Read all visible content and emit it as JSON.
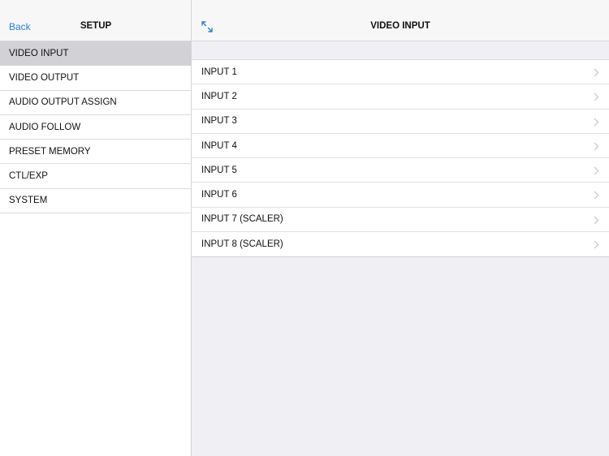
{
  "master": {
    "back_label": "Back",
    "title": "SETUP",
    "selected_index": 0,
    "items": [
      {
        "label": "VIDEO INPUT"
      },
      {
        "label": "VIDEO OUTPUT"
      },
      {
        "label": "AUDIO OUTPUT ASSIGN"
      },
      {
        "label": "AUDIO FOLLOW"
      },
      {
        "label": "PRESET MEMORY"
      },
      {
        "label": "CTL/EXP"
      },
      {
        "label": "SYSTEM"
      }
    ]
  },
  "detail": {
    "title": "VIDEO INPUT",
    "expand_icon": "expand-arrows-icon",
    "rows": [
      {
        "label": "INPUT 1"
      },
      {
        "label": "INPUT 2"
      },
      {
        "label": "INPUT 3"
      },
      {
        "label": "INPUT 4"
      },
      {
        "label": "INPUT 5"
      },
      {
        "label": "INPUT 6"
      },
      {
        "label": "INPUT 7 (SCALER)"
      },
      {
        "label": "INPUT 8 (SCALER)"
      }
    ]
  },
  "colors": {
    "accent": "#2a7fd8",
    "selected_bg": "#d2d2d6",
    "detail_bg": "#efeff4",
    "header_bg": "#f7f7f8"
  }
}
